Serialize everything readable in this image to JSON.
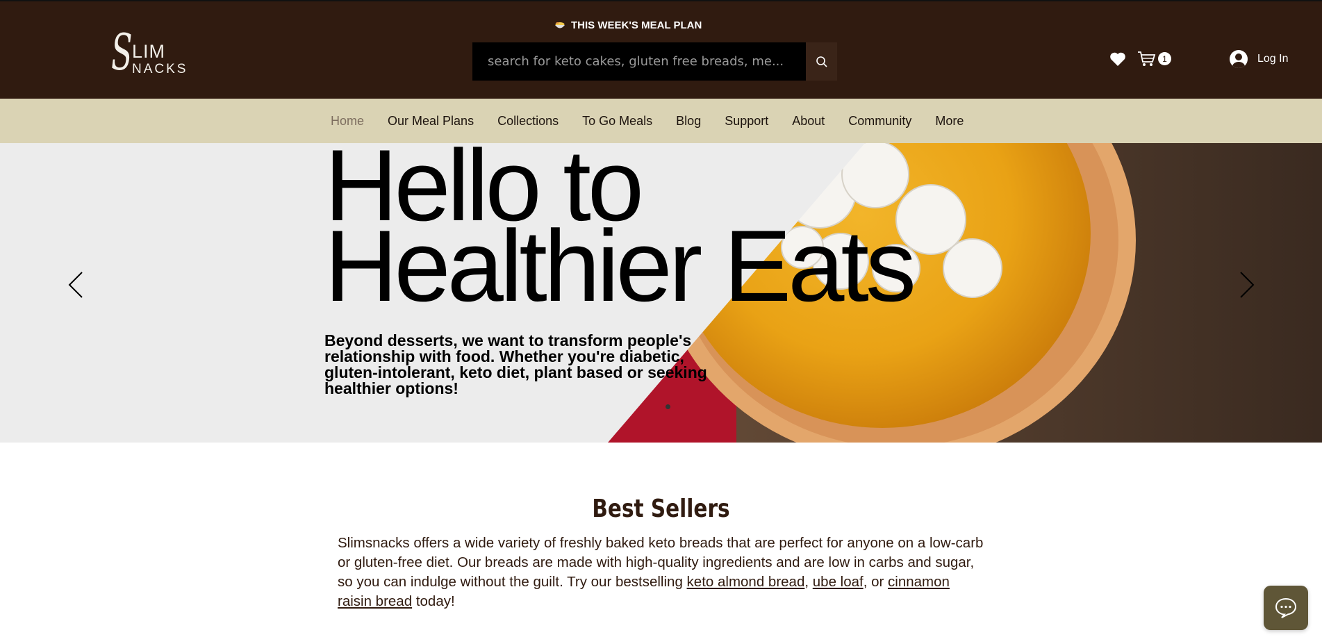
{
  "header": {
    "logo_initial": "S",
    "logo_line1": "LIM",
    "logo_line2": "NACKS",
    "meal_plan_label": "THIS WEEK'S MEAL PLAN",
    "search_placeholder": "search for keto cakes, gluten free breads, me...",
    "cart_count": "1",
    "login_label": "Log In"
  },
  "nav": {
    "items": [
      "Home",
      "Our Meal Plans",
      "Collections",
      "To Go Meals",
      "Blog",
      "Support",
      "About",
      "Community",
      "More"
    ],
    "active": "Home"
  },
  "hero": {
    "title_line1": "Hello to",
    "title_line2": "Healthier Eats",
    "subtitle": "Beyond desserts, we want to transform people's relationship with food. Whether you're diabetic, gluten-intolerant, keto diet, plant based or seeking healthier options!"
  },
  "best_sellers": {
    "title": "Best Sellers",
    "text_before": "Slimsnacks offers a wide variety of freshly baked keto breads that are perfect for anyone on a low-carb or gluten-free diet. Our breads are made with high-quality ingredients and are low in carbs and sugar, so you can indulge without the guilt. Try our bestselling ",
    "link1": "keto almond bread",
    "sep1": ", ",
    "link2": "ube loaf",
    "sep2": ", or ",
    "link3": "cinnamon raisin bread",
    "text_after": " today!"
  },
  "colors": {
    "header_bg": "#301b10",
    "nav_bg": "#dad3b4",
    "chat_bg": "#5f5637"
  }
}
